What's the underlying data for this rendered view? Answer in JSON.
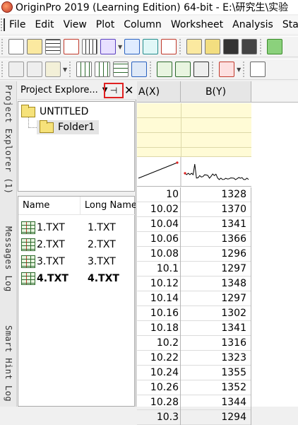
{
  "titlebar": {
    "title": "OriginPro 2019 (Learning Edition) 64-bit - E:\\研究生\\实验"
  },
  "menubar": {
    "items": [
      "File",
      "Edit",
      "View",
      "Plot",
      "Column",
      "Worksheet",
      "Analysis",
      "Stat"
    ]
  },
  "toolbar1": {
    "icons": [
      "new-project-icon",
      "new-folder-icon",
      "new-workbook-icon",
      "new-graph-icon",
      "new-matrix-icon",
      "new-function-icon",
      "new-layout-icon",
      "new-notes-icon",
      "open-icon",
      "open-template-icon",
      "save-icon",
      "save-template-icon",
      "script-icon"
    ]
  },
  "toolbar2": {
    "icons": [
      "cut-icon",
      "copy-icon",
      "paste-icon",
      "add-column-icon",
      "add-xy-column-icon",
      "add-row-icon",
      "clear-worksheet-icon",
      "set-column-values-icon",
      "import-icon",
      "export-icon",
      "fill-icon",
      "text-tool-icon"
    ]
  },
  "sidetabs": [
    "Project Explorer (1)",
    "Messages Log",
    "Smart Hint Log"
  ],
  "project_explorer": {
    "title": "Project Explore...",
    "root": "UNTITLED",
    "folder": "Folder1",
    "columns": {
      "name": "Name",
      "long_name": "Long Name"
    },
    "files": [
      {
        "name": "1.TXT",
        "long_name": "1.TXT",
        "bold": false
      },
      {
        "name": "2.TXT",
        "long_name": "2.TXT",
        "bold": false
      },
      {
        "name": "3.TXT",
        "long_name": "3.TXT",
        "bold": false
      },
      {
        "name": "4.TXT",
        "long_name": "4.TXT",
        "bold": true
      }
    ]
  },
  "worksheet": {
    "col_a": "A(X)",
    "col_b": "B(Y)",
    "rows": [
      {
        "x": "10",
        "y": "1328"
      },
      {
        "x": "10.02",
        "y": "1370"
      },
      {
        "x": "10.04",
        "y": "1341"
      },
      {
        "x": "10.06",
        "y": "1366"
      },
      {
        "x": "10.08",
        "y": "1296"
      },
      {
        "x": "10.1",
        "y": "1297"
      },
      {
        "x": "10.12",
        "y": "1348"
      },
      {
        "x": "10.14",
        "y": "1297"
      },
      {
        "x": "10.16",
        "y": "1302"
      },
      {
        "x": "10.18",
        "y": "1341"
      },
      {
        "x": "10.2",
        "y": "1316"
      },
      {
        "x": "10.22",
        "y": "1323"
      },
      {
        "x": "10.24",
        "y": "1355"
      },
      {
        "x": "10.26",
        "y": "1352"
      },
      {
        "x": "10.28",
        "y": "1344"
      },
      {
        "x": "10.3",
        "y": "1294"
      }
    ]
  },
  "colors": {
    "pin_highlight": "#e02020",
    "meta_rows": "#fffbd6",
    "sparkline": "#000000"
  }
}
